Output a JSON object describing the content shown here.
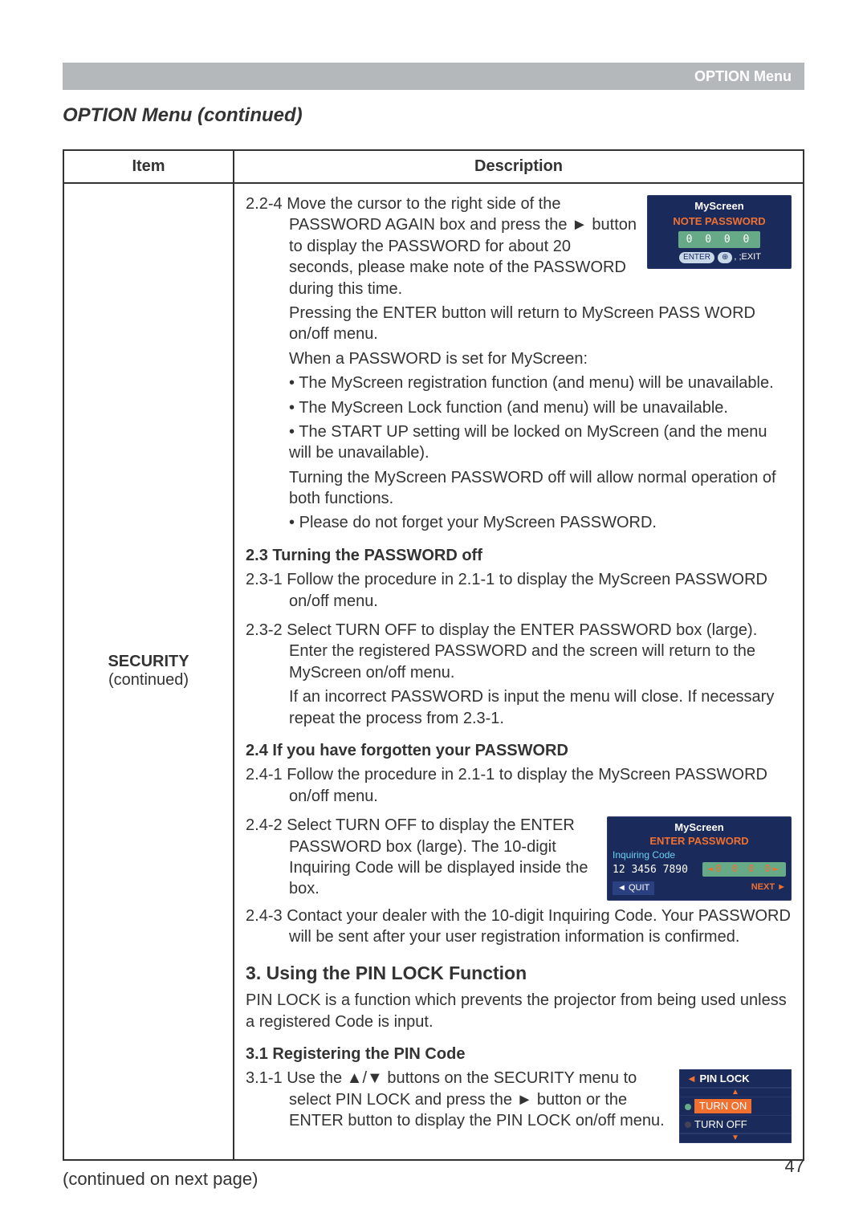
{
  "header": {
    "label": "OPTION Menu"
  },
  "section_title": "OPTION Menu (continued)",
  "table": {
    "head_item": "Item",
    "head_desc": "Description",
    "item_cell": {
      "title": "SECURITY",
      "sub": "(continued)"
    },
    "desc": {
      "p224a": "2.2-4 Move the cursor to the right side of the PASSWORD AGAIN box and press the ► button to display the PASSWORD for about 20 seconds, please make note of the PASSWORD during this time.",
      "p224b": "Pressing the ENTER button will return to MyScreen PASS WORD on/off menu.",
      "p224c": "When a PASSWORD is set for MyScreen:",
      "b1": "• The MyScreen registration function (and menu) will be unavailable.",
      "b2": "• The MyScreen Lock function (and menu) will be unavailable.",
      "b3": "• The START UP setting will be locked on MyScreen (and the menu will be unavailable).",
      "p224d": "Turning the MyScreen PASSWORD off will allow normal operation of both functions.",
      "b4": "• Please do not forget your MyScreen PASSWORD.",
      "h23": "2.3 Turning the PASSWORD off",
      "p231": "2.3-1 Follow the procedure in 2.1-1 to display the MyScreen PASSWORD on/off menu.",
      "p232": "2.3-2 Select TURN OFF to display the ENTER PASSWORD box (large). Enter the registered PASSWORD and the screen will return to the MyScreen on/off menu.",
      "p232b": "If an incorrect PASSWORD is input the menu will close. If necessary repeat the process from 2.3-1.",
      "h24": "2.4 If you have forgotten your PASSWORD",
      "p241": "2.4-1 Follow the procedure in 2.1-1 to display the MyScreen PASSWORD on/off menu.",
      "p242": "2.4-2 Select TURN OFF to display the ENTER PASSWORD box (large). The 10-digit Inquiring Code will be displayed inside the box.",
      "p243": "2.4-3 Contact your dealer with the 10-digit Inquiring Code. Your PASSWORD will be sent after your user registration information is confirmed.",
      "h3": "3. Using the PIN LOCK Function",
      "p3": "PIN LOCK is a function which prevents the projector from being used unless a registered Code is input.",
      "h31": "3.1 Registering the PIN Code",
      "p311": "3.1-1 Use the ▲/▼ buttons on the SECURITY menu to select PIN LOCK and press the ► button or the ENTER button to display the PIN LOCK on/off menu."
    }
  },
  "osd_note": {
    "line1": "MyScreen",
    "line2": "NOTE PASSWORD",
    "pwd": "0 0 0 0",
    "hint_enter": "ENTER",
    "hint_exit": ",   ;EXIT"
  },
  "osd_enter": {
    "t1": "MyScreen",
    "t2": "ENTER PASSWORD",
    "t3": "Inquiring Code",
    "t4": "12 3456 7890",
    "pwd": "0 0 0 0",
    "quit": "◄ QUIT",
    "next": "NEXT ►"
  },
  "osd_pin": {
    "title": "PIN LOCK",
    "on": "TURN ON",
    "off": "TURN OFF"
  },
  "continued": "(continued on next page)",
  "page_number": "47"
}
